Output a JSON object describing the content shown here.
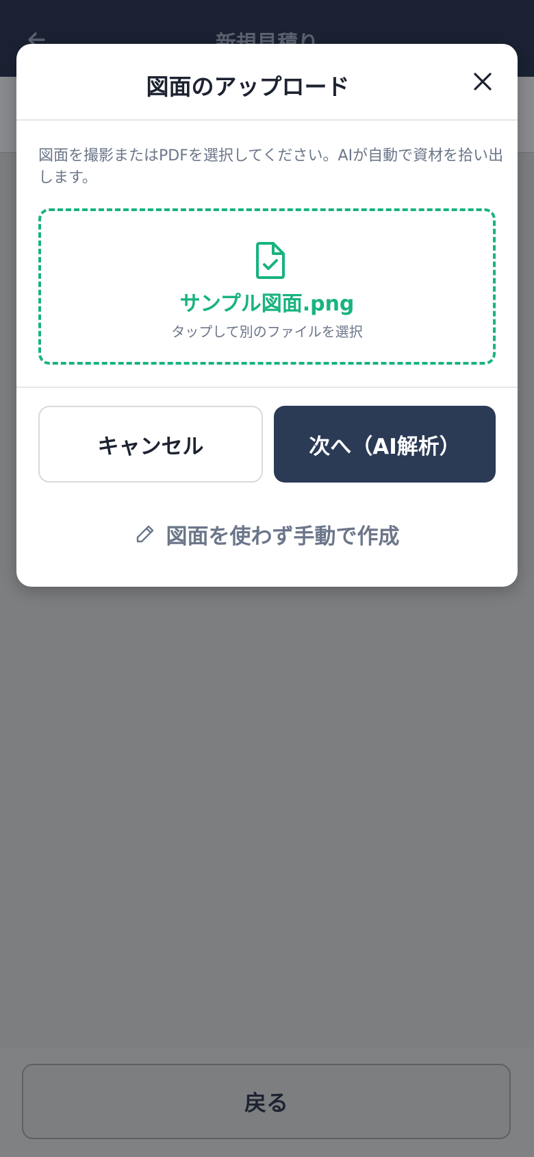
{
  "app": {
    "header_title": "新規見積り",
    "back_button_label": "戻る"
  },
  "modal": {
    "title": "図面のアップロード",
    "description": "図面を撮影またはPDFを選択してください。AIが自動で資材を拾い出します。",
    "dropzone": {
      "file_name": "サンプル図面.png",
      "hint": "タップして別のファイルを選択"
    },
    "cancel_label": "キャンセル",
    "next_label": "次へ（AI解析）",
    "manual_label": "図面を使わず手動で作成"
  },
  "colors": {
    "accent_green": "#18b37e",
    "primary_navy": "#2b3a55",
    "header_bg": "#1a2233"
  },
  "icons": {
    "back": "arrow-left-icon",
    "close": "close-icon",
    "file": "file-check-icon",
    "edit": "pencil-icon"
  }
}
